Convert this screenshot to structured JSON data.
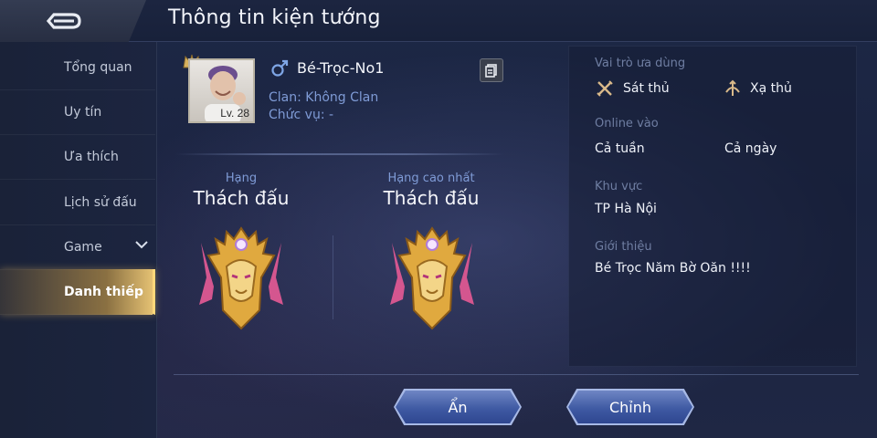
{
  "header": {
    "title": "Thông tin kiện tướng"
  },
  "sidebar": {
    "items": [
      {
        "label": "Tổng quan"
      },
      {
        "label": "Uy tín"
      },
      {
        "label": "Ưa thích"
      },
      {
        "label": "Lịch sử đấu"
      },
      {
        "label": "Game"
      },
      {
        "label": "Danh thiếp",
        "active": true
      }
    ]
  },
  "profile": {
    "level": "Lv. 28",
    "name": "Bé-Trọc-No1",
    "clan": "Clan: Không Clan",
    "position": "Chức vụ: -"
  },
  "ranks": {
    "current": {
      "label": "Hạng",
      "value": "Thách đấu"
    },
    "highest": {
      "label": "Hạng cao nhất",
      "value": "Thách đấu"
    }
  },
  "info": {
    "role_label": "Vai trò ưa dùng",
    "roles": [
      {
        "name": "Sát thủ",
        "icon": "assassin-icon"
      },
      {
        "name": "Xạ thủ",
        "icon": "marksman-icon"
      }
    ],
    "online_label": "Online vào",
    "online_days": "Cả tuần",
    "online_time": "Cả ngày",
    "region_label": "Khu vực",
    "region": "TP Hà Nội",
    "intro_label": "Giới thiệu",
    "intro": "Bé Trọc Năm Bờ Oăn !!!!"
  },
  "buttons": {
    "hide": "Ẩn",
    "edit": "Chỉnh"
  },
  "colors": {
    "accent_gold": "#e6b24a",
    "label_blue": "#7f9bd6",
    "button_blue": "#4a64ab"
  }
}
